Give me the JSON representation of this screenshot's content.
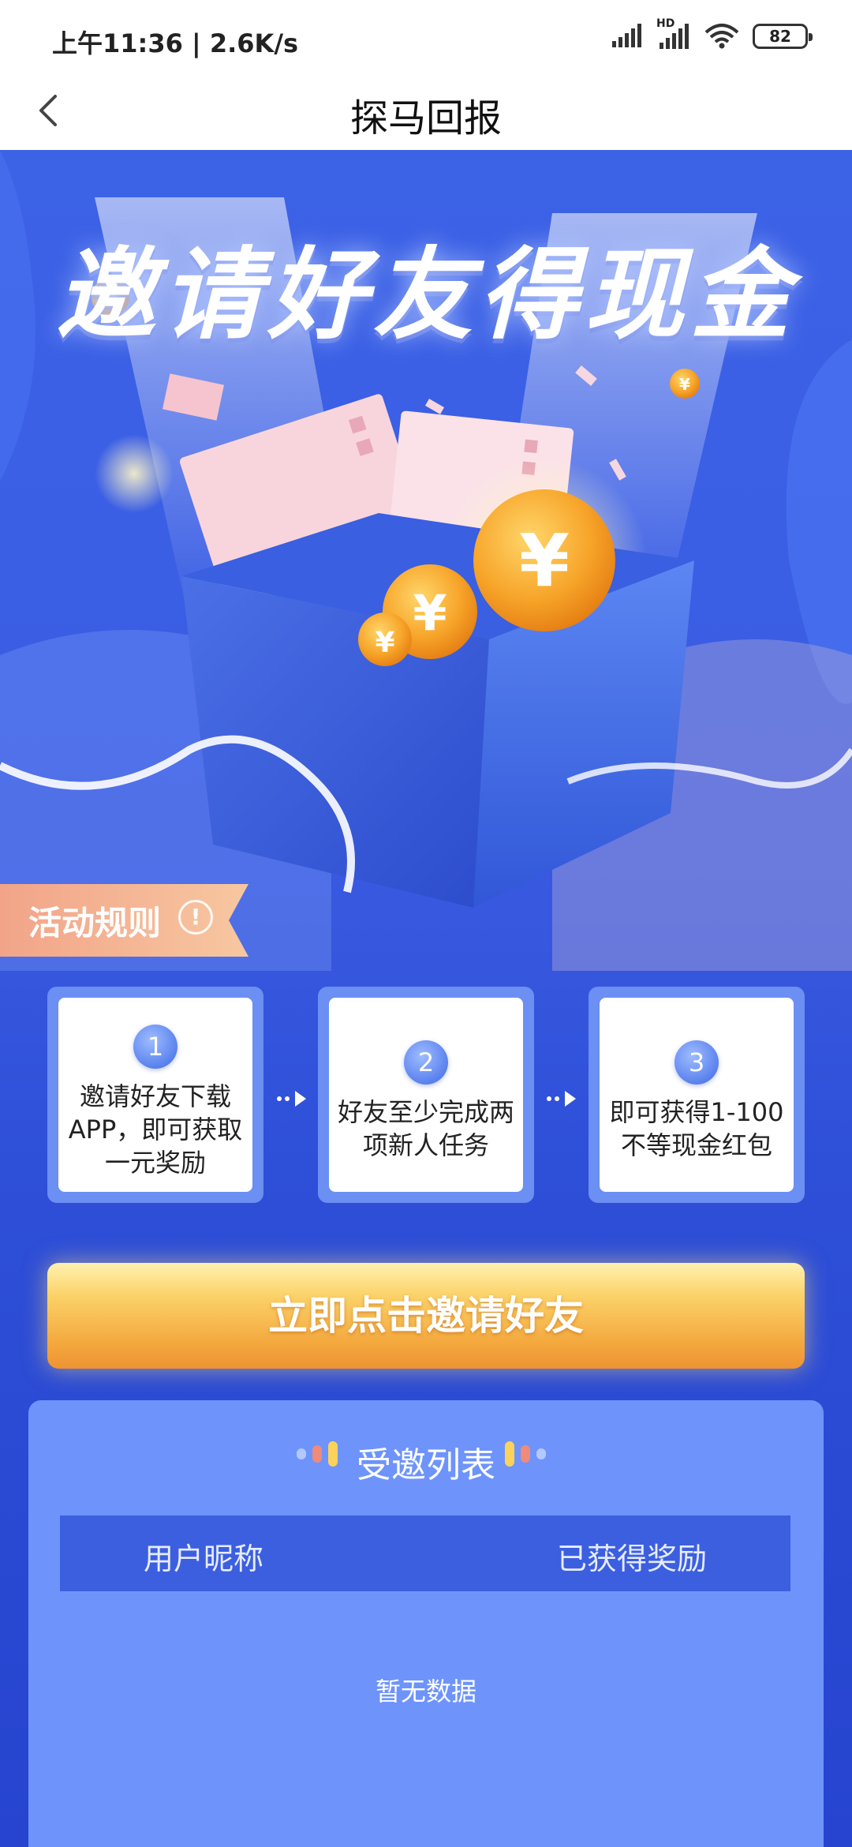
{
  "status": {
    "time_speed": "上午11:36 | 2.6K/s",
    "network_label": "HD",
    "battery": "82"
  },
  "nav": {
    "title": "探马回报"
  },
  "hero": {
    "title": "邀请好友得现金"
  },
  "rules": {
    "label": "活动规则",
    "icon": "!"
  },
  "steps": [
    {
      "num": "1",
      "text": [
        "邀请好友下载",
        "APP，即可获取",
        "一元奖励"
      ]
    },
    {
      "num": "2",
      "text": [
        "好友至少完成两",
        "项新人任务"
      ]
    },
    {
      "num": "3",
      "text": [
        "即可获得1-100",
        "不等现金红包"
      ]
    }
  ],
  "cta": {
    "label": "立即点击邀请好友"
  },
  "invite_list": {
    "title": "受邀列表",
    "col_user": "用户昵称",
    "col_reward": "已获得奖励",
    "empty_text": "暂无数据"
  },
  "colors": {
    "background_blue": "#3a5de4",
    "panel_blue": "#6e94fb",
    "cta_orange": "#f4a93e"
  }
}
